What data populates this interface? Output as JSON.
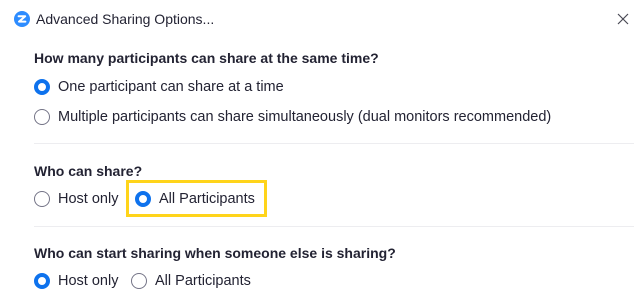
{
  "window": {
    "title": "Advanced Sharing Options..."
  },
  "sections": [
    {
      "title": "How many participants can share at the same time?",
      "options": [
        {
          "label": "One participant can share at a time",
          "selected": true
        },
        {
          "label": "Multiple participants can share simultaneously (dual monitors recommended)",
          "selected": false
        }
      ]
    },
    {
      "title": "Who can share?",
      "options": [
        {
          "label": "Host only",
          "selected": false
        },
        {
          "label": "All Participants",
          "selected": true
        }
      ]
    },
    {
      "title": "Who can start sharing when someone else is sharing?",
      "options": [
        {
          "label": "Host only",
          "selected": true
        },
        {
          "label": "All Participants",
          "selected": false
        }
      ]
    }
  ],
  "colors": {
    "accent": "#0E72ED",
    "highlight": "#FFD41A",
    "logo": "#2D8CFF"
  }
}
